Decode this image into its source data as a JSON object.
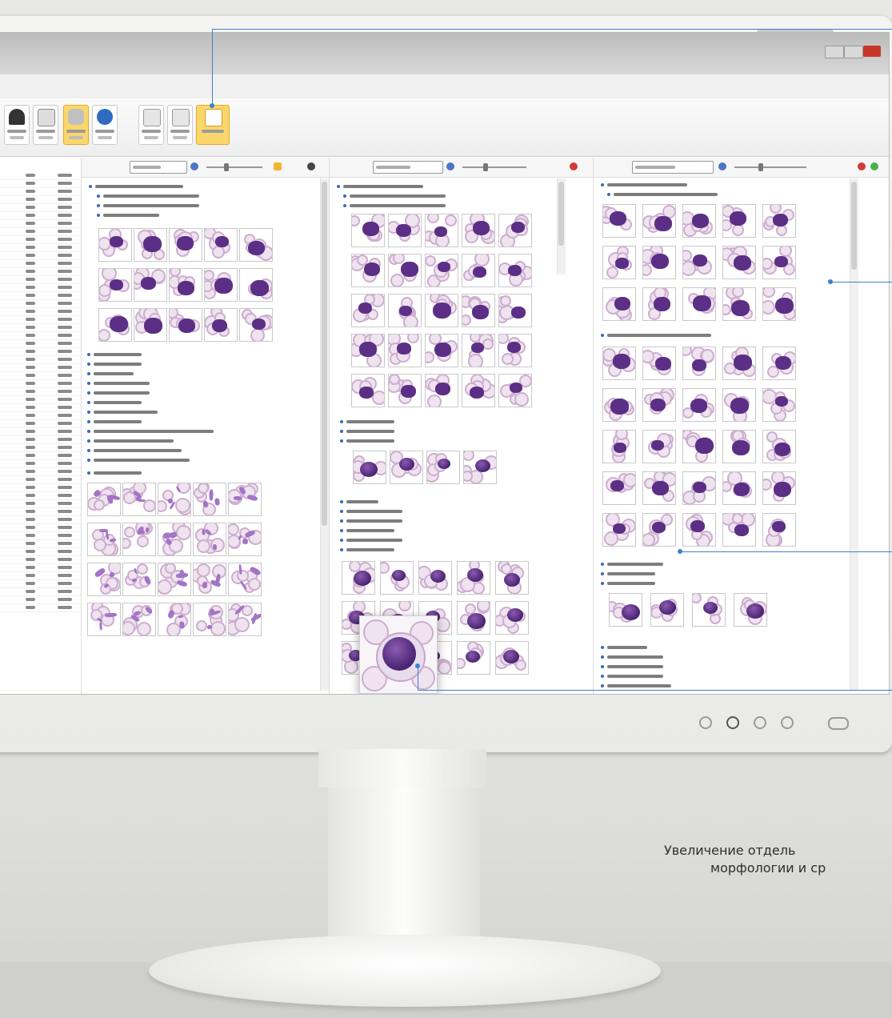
{
  "callout": {
    "text_line1": "Увеличение отдель",
    "text_line2": "морфологии и ср"
  },
  "app": {
    "title": "",
    "toolbar": {
      "buttons": [
        "",
        "",
        "",
        "",
        "",
        "",
        "",
        "",
        ""
      ],
      "active_button": "results"
    },
    "panels": [
      {
        "filter_value": ""
      },
      {
        "filter_value": ""
      },
      {
        "filter_value": ""
      }
    ],
    "tree": {
      "categories": []
    }
  },
  "colors": {
    "accent_callout": "#3f7fd0",
    "active_ribbon": "#fbd76b",
    "cell_nucleus": "#5c2f86",
    "rbc_fill": "#efe3ef"
  },
  "icons": [
    "microscope-icon",
    "report-icon",
    "database-icon",
    "refresh-icon",
    "monitor-icon",
    "chart-icon",
    "results-icon",
    "settings-icon"
  ]
}
